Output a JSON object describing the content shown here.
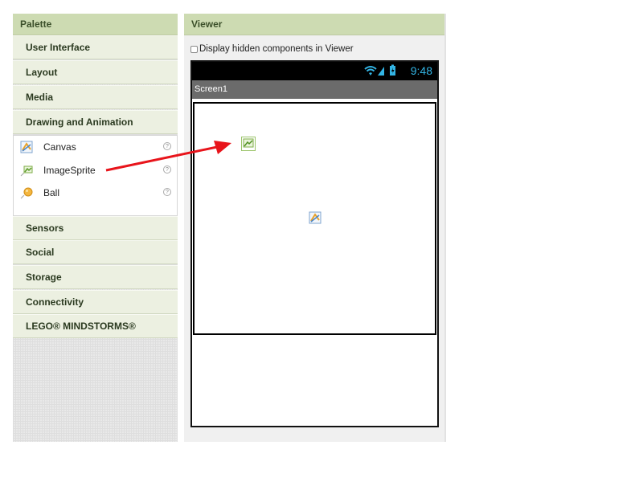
{
  "palette": {
    "header": "Palette",
    "drawers": [
      {
        "label": "User Interface"
      },
      {
        "label": "Layout"
      },
      {
        "label": "Media"
      },
      {
        "label": "Drawing and Animation"
      },
      {
        "label": "Sensors"
      },
      {
        "label": "Social"
      },
      {
        "label": "Storage"
      },
      {
        "label": "Connectivity"
      },
      {
        "label": "LEGO® MINDSTORMS®"
      }
    ],
    "open_drawer_items": [
      {
        "label": "Canvas",
        "icon": "canvas-icon",
        "help": "?"
      },
      {
        "label": "ImageSprite",
        "icon": "imagesprite-icon",
        "help": "?"
      },
      {
        "label": "Ball",
        "icon": "ball-icon",
        "help": "?"
      }
    ]
  },
  "viewer": {
    "header": "Viewer",
    "hidden_components_label": "Display hidden components in Viewer",
    "status_time": "9:48",
    "screen_title": "Screen1"
  },
  "colors": {
    "header_bg": "#cddbb2",
    "drawer_bg": "#ecf0e1",
    "status_accent": "#33b5e5",
    "arrow": "#e8141b"
  }
}
